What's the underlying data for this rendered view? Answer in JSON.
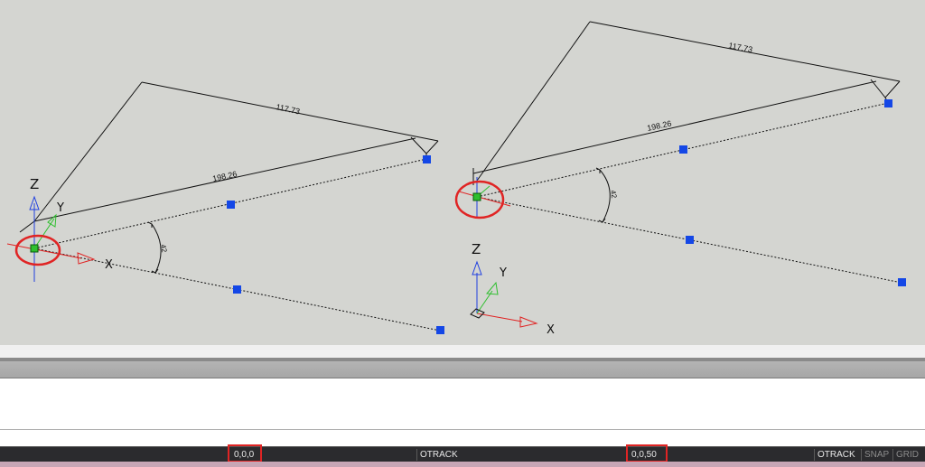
{
  "viewport_left": {
    "dim_long": "198.26",
    "dim_short": "117.73",
    "angle": "42",
    "axis_x": "X",
    "axis_y": "Y",
    "axis_z": "Z"
  },
  "viewport_right": {
    "dim_long": "198.26",
    "dim_short": "117.73",
    "angle": "42",
    "axis_x": "X",
    "axis_y": "Y",
    "axis_z": "Z"
  },
  "colors": {
    "highlight": "#e02424",
    "grip": "#1447e6",
    "x_axis": "#e02424",
    "y_axis": "#2fbf2f",
    "z_axis": "#2040e0"
  },
  "statusbar": {
    "coord_left": "0,0,0",
    "otrack_left": "OTRACK",
    "coord_right": "0,0,50",
    "otrack_right": "OTRACK",
    "snap": "SNAP",
    "grid": "GRID"
  }
}
